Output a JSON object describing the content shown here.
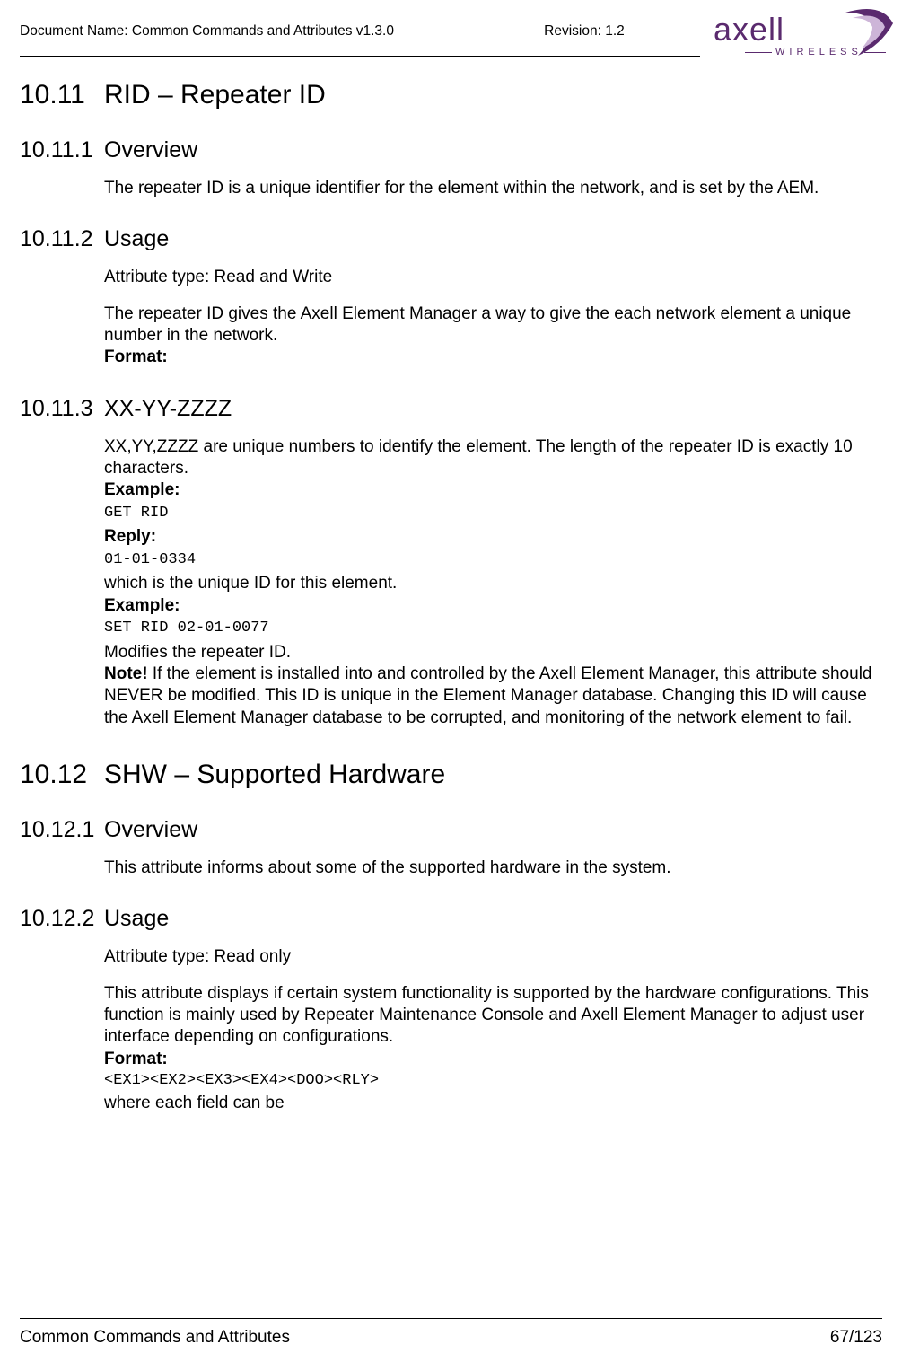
{
  "header": {
    "doc_label": "Document Name: ",
    "doc_name": "Common Commands and Attributes v1.3.0",
    "rev_label": "Revision: ",
    "revision": "1.2"
  },
  "logo": {
    "brand": "axell",
    "tagline": "WIRELESS"
  },
  "s1": {
    "num": "10.11",
    "title": "RID – Repeater ID"
  },
  "s1_1": {
    "num": "10.11.1",
    "title": "Overview",
    "p1": "The repeater ID is a unique identifier for the element within the network, and is set by the AEM."
  },
  "s1_2": {
    "num": "10.11.2",
    "title": "Usage",
    "p1": "Attribute type: Read and Write",
    "p2": "The repeater ID gives the Axell Element Manager a way to give the each network element a unique number in the network.",
    "format_label": "Format:"
  },
  "s1_3": {
    "num": "10.11.3",
    "title": "XX-YY-ZZZZ",
    "p1": "XX,YY,ZZZZ are unique numbers to identify the element. The length of the repeater ID  is exactly 10 characters.",
    "example_label": "Example:",
    "cmd1": "GET RID",
    "reply_label": "Reply:",
    "reply1": "01-01-0334",
    "p2": "which is the unique ID for this element.",
    "example_label2": "Example:",
    "cmd2": "SET RID 02-01-0077",
    "p3": "Modifies the repeater ID.",
    "note_label": "Note!",
    "note_body": " If the element is installed into and controlled by the Axell Element Manager, this attribute should NEVER be modified. This ID is unique in the Element Manager database. Changing this ID will cause the Axell Element Manager database to be corrupted, and monitoring of the network element to fail."
  },
  "s2": {
    "num": "10.12",
    "title": "SHW – Supported Hardware"
  },
  "s2_1": {
    "num": "10.12.1",
    "title": "Overview",
    "p1": "This attribute informs about some of the supported hardware in the system."
  },
  "s2_2": {
    "num": "10.12.2",
    "title": "Usage",
    "p1": "Attribute type: Read only",
    "p2": "This attribute displays if certain system functionality is supported by the hardware configurations. This function is mainly used by Repeater Maintenance Console and Axell Element Manager to adjust user interface depending on configurations.",
    "format_label": "Format:",
    "format_value": "<EX1><EX2><EX3><EX4><DOO><RLY>",
    "p3": "where each field can be"
  },
  "footer": {
    "title": "Common Commands and Attributes",
    "page": "67/123"
  }
}
